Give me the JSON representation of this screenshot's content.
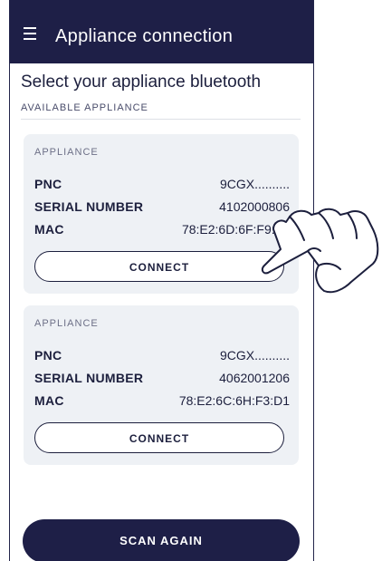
{
  "appbar": {
    "title": "Appliance connection",
    "menu_icon": "hamburger-menu-icon"
  },
  "heading": "Select your appliance bluetooth",
  "subheading": "AVAILABLE APPLIANCE",
  "appliances": [
    {
      "card_title": "APPLIANCE",
      "pnc_label": "PNC",
      "pnc_value": "9CGX..........",
      "serial_label": "SERIAL NUMBER",
      "serial_value": "4102000806",
      "mac_label": "MAC",
      "mac_value": "78:E2:6D:6F:F9:F8",
      "connect_label": "CONNECT"
    },
    {
      "card_title": "APPLIANCE",
      "pnc_label": "PNC",
      "pnc_value": "9CGX..........",
      "serial_label": "SERIAL NUMBER",
      "serial_value": "4062001206",
      "mac_label": "MAC",
      "mac_value": "78:E2:6C:6H:F3:D1",
      "connect_label": "CONNECT"
    }
  ],
  "scan_again_label": "SCAN AGAIN",
  "colors": {
    "primary": "#1e1f47",
    "card_bg": "#eef1f5",
    "text": "#1c1f3d"
  }
}
